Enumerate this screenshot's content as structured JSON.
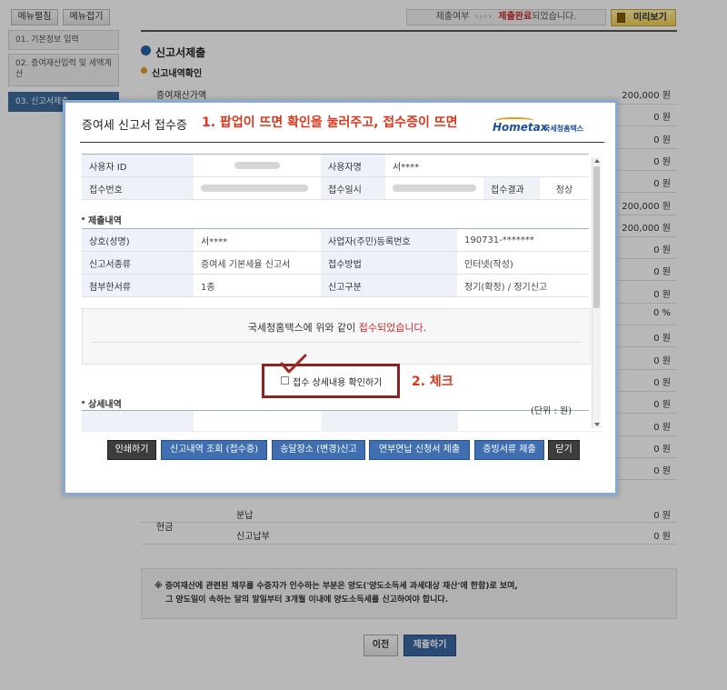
{
  "side_menu": {
    "open_label": "메뉴펼침",
    "close_label": "메뉴접기",
    "items": [
      {
        "label": "01. 기본정보 입력"
      },
      {
        "label": "02. 증여재산입력 및 세액계산"
      },
      {
        "label": "03. 신고서제출"
      }
    ]
  },
  "topbar": {
    "status_label": "제출여부",
    "status_arrows": "››››",
    "status_done": "제출완료",
    "status_suffix": "되었습니다.",
    "preview_label": "미리보기"
  },
  "main": {
    "title": "신고서제출",
    "subtitle": "신고내역확인",
    "rows": [
      {
        "label": "증여재산가액",
        "value": "200,000 원"
      },
      {
        "label": "",
        "value": "0 원"
      },
      {
        "label": "",
        "value": "0 원"
      },
      {
        "label": "",
        "value": "0 원"
      },
      {
        "label": "",
        "value": "0 원"
      },
      {
        "label": "",
        "value": "200,000 원"
      },
      {
        "label": "",
        "value": "200,000 원"
      },
      {
        "label": "",
        "value": "0 원"
      },
      {
        "label": "",
        "value": "0 원"
      },
      {
        "label": "",
        "value": "0 원"
      },
      {
        "label": "",
        "value": "0 %"
      },
      {
        "label": "",
        "value": "0 원"
      },
      {
        "label": "",
        "value": "0 원"
      },
      {
        "label": "",
        "value": "0 원"
      },
      {
        "label": "",
        "value": "0 원"
      },
      {
        "label": "",
        "value": "0 원"
      },
      {
        "label": "",
        "value": "0 원"
      },
      {
        "label": "",
        "value": "0 원"
      }
    ],
    "cash_label": "현금",
    "bunnap_label": "분납",
    "bunnap_value": "0 원",
    "singo_label": "신고납부",
    "singo_value": "0 원",
    "notice_line1": "※ 증여재산에 관련된 채무를 수증자가 인수하는 부분은 양도('양도소득세 과세대상 재산'에 한함)로 보며,",
    "notice_line2": "그 양도일이 속하는 달의 말일부터 3개월 이내에 양도소득세를 신고하여야 합니다.",
    "prev_label": "이전",
    "submit_label": "제출하기"
  },
  "popup": {
    "title": "증여세 신고서 접수증",
    "annotation1": "1. 팝업이 뜨면 확인을 눌러주고, 접수증이 뜨면",
    "logo_home": "Hometax",
    "logo_kr": "국세청홈택스",
    "user_id_label": "사용자 ID",
    "user_name_label": "사용자명",
    "user_name_value": "서****",
    "receipt_no_label": "접수번호",
    "receipt_date_label": "접수일시",
    "receipt_result_label": "접수결과",
    "receipt_result_value": "정상",
    "submission_section": "제출내역",
    "trade_name_label": "상호(성명)",
    "trade_name_value": "서****",
    "biz_no_label": "사업자(주민)등록번호",
    "biz_no_value": "190731-*******",
    "form_type_label": "신고서종류",
    "form_type_value": "증여세 기본세율 신고서",
    "receipt_method_label": "접수방법",
    "receipt_method_value": "인터넷(작성)",
    "attach_label": "첨부한서류",
    "attach_value": "1종",
    "report_type_label": "신고구분",
    "report_type_value": "정기(확정) / 정기신고",
    "message_prefix": "국세청홈택스에 위와 같이 ",
    "message_red": "접수되었습니다.",
    "checkbox_label": "접수 상세내용 확인하기",
    "annotation2": "2. 체크",
    "detail_section": "상세내역",
    "unit_label": "(단위 : 원)",
    "buttons": {
      "print": "인쇄하기",
      "history": "신고내역 조회 (접수증)",
      "address": "송달장소 (변경)신고",
      "installment": "연부연납 신청서 제출",
      "evidence": "증빙서류 제출",
      "close": "닫기"
    }
  }
}
